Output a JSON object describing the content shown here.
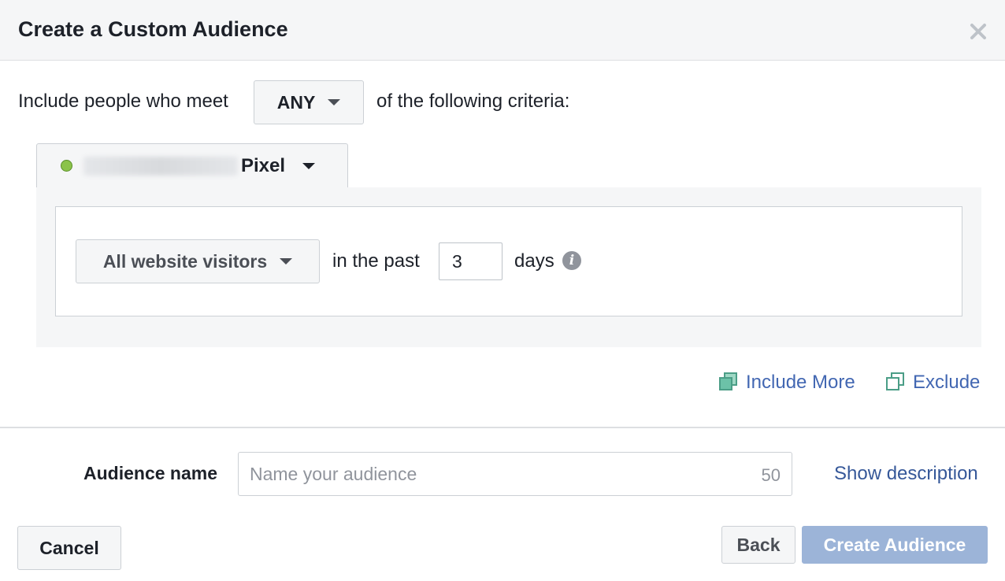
{
  "dialog": {
    "title": "Create a Custom Audience"
  },
  "criteria": {
    "prefix": "Include people who meet",
    "match_value": "ANY",
    "suffix": "of the following criteria:"
  },
  "pixel": {
    "label": "Pixel",
    "status_color": "#8bc34a"
  },
  "rule": {
    "visitor_type": "All website visitors",
    "in_the_past_label": "in the past",
    "days_value": "3",
    "days_label": "days"
  },
  "actions": {
    "include_more": "Include More",
    "exclude": "Exclude"
  },
  "audience_name": {
    "label": "Audience name",
    "placeholder": "Name your audience",
    "char_count": "50",
    "show_description": "Show description"
  },
  "footer": {
    "cancel": "Cancel",
    "back": "Back",
    "create": "Create Audience"
  },
  "colors": {
    "link": "#4267b2",
    "primary_disabled": "#9cb4d8",
    "header_bg": "#f5f6f7"
  }
}
